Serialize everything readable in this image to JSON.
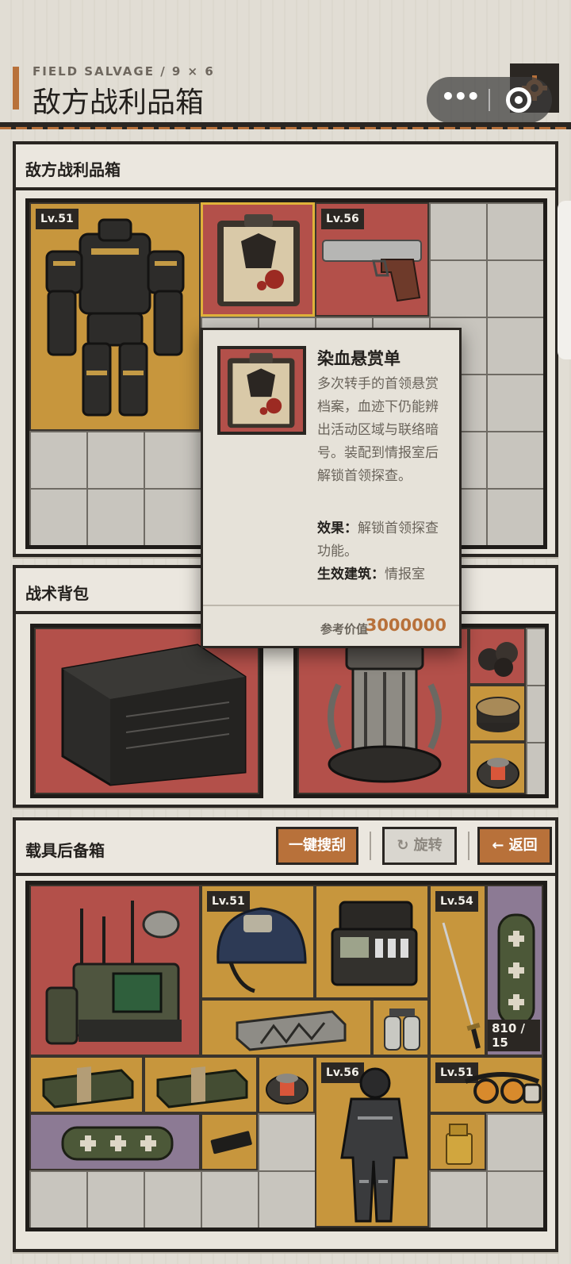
{
  "header": {
    "subtitle": "FIELD SALVAGE / 9 × 6",
    "title": "敌方战利品箱",
    "menu_dots": "•••"
  },
  "enemy_box": {
    "title": "敌方战利品箱",
    "items": [
      {
        "name": "armor-suit",
        "level": "Lv.51",
        "rarity": "gold"
      },
      {
        "name": "bounty-clipboard",
        "level": "",
        "rarity": "red"
      },
      {
        "name": "pistol",
        "level": "Lv.56",
        "rarity": "red"
      }
    ]
  },
  "backpack": {
    "title": "战术背包",
    "items": [
      {
        "name": "armored-crate",
        "rarity": "red"
      },
      {
        "name": "reactor-core",
        "rarity": "red"
      },
      {
        "name": "truffles",
        "rarity": "red"
      },
      {
        "name": "tin-can",
        "rarity": "gold"
      },
      {
        "name": "device-module",
        "rarity": "gold"
      }
    ]
  },
  "vehicle_box": {
    "title": "载具后备箱",
    "buttons": {
      "loot_all": "一键搜刮",
      "rotate": "旋转",
      "back": "返回"
    },
    "items": [
      {
        "name": "radio-station",
        "level": "",
        "rarity": "red"
      },
      {
        "name": "tactical-helmet",
        "level": "Lv.51",
        "rarity": "gold"
      },
      {
        "name": "field-kit-case",
        "level": "",
        "rarity": "gold"
      },
      {
        "name": "katana",
        "level": "Lv.54",
        "rarity": "gold"
      },
      {
        "name": "medical-roll",
        "level": "",
        "rarity": "purple",
        "count": "810 / 15"
      },
      {
        "name": "ammo-crate",
        "level": "",
        "rarity": "gold"
      },
      {
        "name": "gas-canisters",
        "level": "",
        "rarity": "gold"
      },
      {
        "name": "supply-crate-1",
        "level": "",
        "rarity": "gold"
      },
      {
        "name": "supply-crate-2",
        "level": "",
        "rarity": "gold"
      },
      {
        "name": "mini-reactor",
        "level": "",
        "rarity": "gold"
      },
      {
        "name": "hazmat-suit",
        "level": "Lv.56",
        "rarity": "gold"
      },
      {
        "name": "goggles",
        "level": "Lv.51",
        "rarity": "gold"
      },
      {
        "name": "medical-roll-2",
        "level": "",
        "rarity": "purple"
      },
      {
        "name": "chip-card",
        "level": "",
        "rarity": "gold"
      },
      {
        "name": "lighter",
        "level": "",
        "rarity": "gold"
      }
    ]
  },
  "tooltip": {
    "name": "染血悬赏单",
    "description": "多次转手的首领悬赏档案，血迹下仍能辨出活动区域与联络暗号。装配到情报室后解锁首领探查。",
    "effect_label": "效果：",
    "effect": "解锁首领探查功能。",
    "building_label": "生效建筑：",
    "building": "情报室",
    "price_label": "参考价值",
    "price": "3000000"
  },
  "colors": {
    "red": "#b3504a",
    "gold": "#c7963d",
    "purple": "#8c7a94",
    "accent": "#b8713a"
  }
}
